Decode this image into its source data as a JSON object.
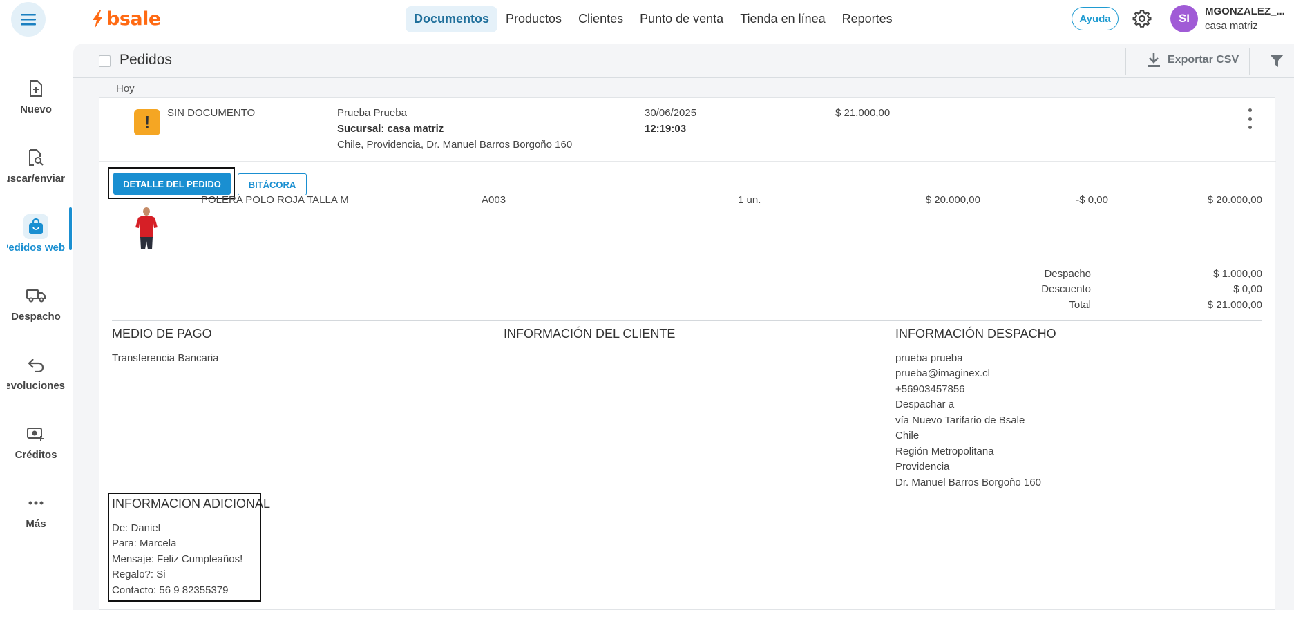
{
  "brand": {
    "name": "bsale",
    "color": "#ff6a13"
  },
  "nav": {
    "items": [
      "Documentos",
      "Productos",
      "Clientes",
      "Punto de venta",
      "Tienda en línea",
      "Reportes"
    ],
    "active": "Documentos"
  },
  "header_right": {
    "help_label": "Ayuda",
    "avatar_initials": "SI",
    "user_name": "MGONZALEZ_...",
    "branch": "casa matriz"
  },
  "sidebar": {
    "items": [
      {
        "label": "Nuevo",
        "icon": "new-document-icon"
      },
      {
        "label": "Buscar/enviar",
        "icon": "search-document-icon"
      },
      {
        "label": "Pedidos web",
        "icon": "shopping-bag-icon"
      },
      {
        "label": "Despacho",
        "icon": "truck-icon"
      },
      {
        "label": "Devoluciones",
        "icon": "return-arrow-icon"
      },
      {
        "label": "Créditos",
        "icon": "money-icon"
      },
      {
        "label": "Más",
        "icon": "more-dots-icon"
      }
    ],
    "active": "Pedidos web"
  },
  "page": {
    "title": "Pedidos",
    "export_label": "Exportar CSV",
    "group_label": "Hoy"
  },
  "order": {
    "status": "SIN DOCUMENTO",
    "customer": "Prueba Prueba",
    "branch": "Sucursal: casa matriz",
    "address": "Chile, Providencia, Dr. Manuel Barros Borgoño 160",
    "date": "30/06/2025",
    "time": "12:19:03",
    "total": "$ 21.000,00"
  },
  "tabs": {
    "detail": "DETALLE DEL PEDIDO",
    "log": "BITÁCORA"
  },
  "line_item": {
    "name": "POLERA POLO ROJA TALLA M",
    "sku": "A003",
    "qty": "1 un.",
    "price": "$ 20.000,00",
    "discount": "-$ 0,00",
    "subtotal": "$ 20.000,00"
  },
  "totals": {
    "rows": [
      {
        "label": "Despacho",
        "value": "$ 1.000,00"
      },
      {
        "label": "Descuento",
        "value": "$ 0,00"
      },
      {
        "label": "Total",
        "value": "$ 21.000,00"
      }
    ]
  },
  "payment": {
    "title": "MEDIO DE PAGO",
    "method": "Transferencia Bancaria"
  },
  "client_info": {
    "title": "INFORMACIÓN DEL CLIENTE"
  },
  "shipping": {
    "title": "INFORMACIÓN DESPACHO",
    "lines": [
      "prueba prueba",
      "prueba@imaginex.cl",
      "+56903457856",
      "Despachar a",
      "vía Nuevo Tarifario de Bsale",
      "Chile",
      "Región Metropolitana",
      "Providencia",
      "Dr. Manuel Barros Borgoño 160"
    ]
  },
  "additional": {
    "title": "INFORMACION ADICIONAL",
    "lines": [
      "De: Daniel",
      "Para: Marcela",
      "Mensaje: Feliz Cumpleaños!",
      "Regalo?: Si",
      "Contacto: 56 9 82355379"
    ]
  },
  "colors": {
    "accent": "#1a8fd1",
    "warning": "#f5a623",
    "avatar": "#a05bd6"
  }
}
